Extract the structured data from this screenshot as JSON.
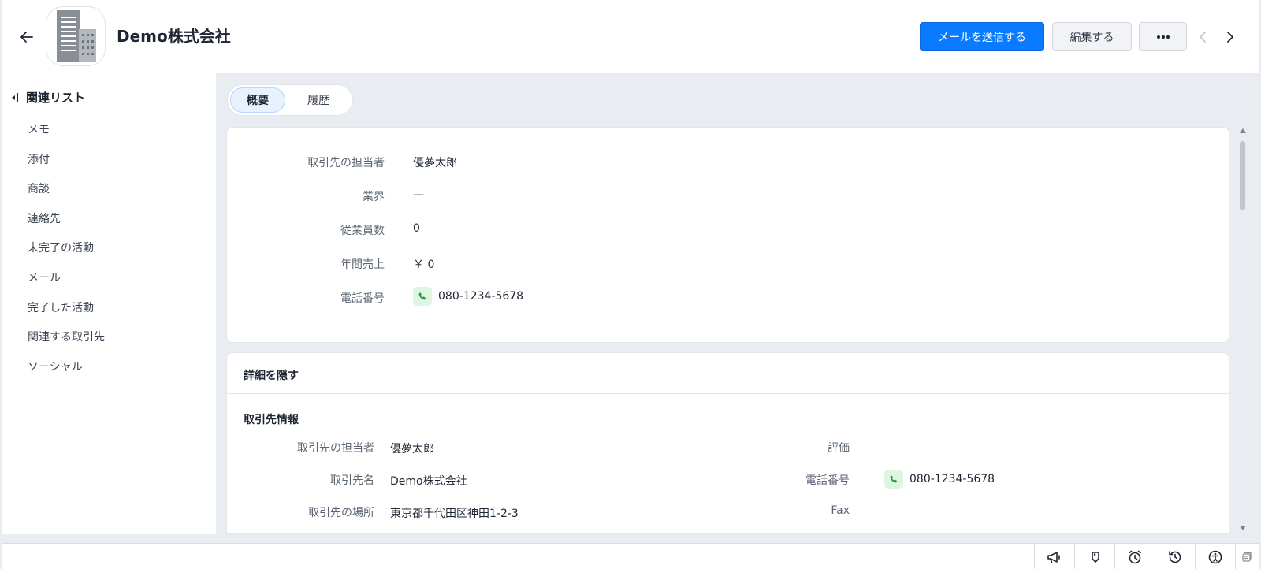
{
  "header": {
    "title": "Demo株式会社",
    "send_mail_label": "メールを送信する",
    "edit_label": "編集する",
    "more_label": "•••"
  },
  "sidebar": {
    "heading": "関連リスト",
    "items": [
      {
        "label": "メモ"
      },
      {
        "label": "添付"
      },
      {
        "label": "商談"
      },
      {
        "label": "連絡先"
      },
      {
        "label": "未完了の活動"
      },
      {
        "label": "メール"
      },
      {
        "label": "完了した活動"
      },
      {
        "label": "関連する取引先"
      },
      {
        "label": "ソーシャル"
      }
    ]
  },
  "tabs": [
    {
      "label": "概要",
      "active": true
    },
    {
      "label": "履歴",
      "active": false
    }
  ],
  "summary": {
    "fields": [
      {
        "label": "取引先の担当者",
        "value": "優夢太郎"
      },
      {
        "label": "業界",
        "value": "—"
      },
      {
        "label": "従業員数",
        "value": "0"
      },
      {
        "label": "年間売上",
        "value": "￥ 0"
      },
      {
        "label": "電話番号",
        "value": "080-1234-5678"
      }
    ]
  },
  "details": {
    "toggle_label": "詳細を隠す",
    "section_title": "取引先情報",
    "left_fields": [
      {
        "label": "取引先の担当者",
        "value": "優夢太郎"
      },
      {
        "label": "取引先名",
        "value": "Demo株式会社"
      },
      {
        "label": "取引先の場所",
        "value": "東京都千代田区神田1-2-3"
      }
    ],
    "right_fields": [
      {
        "label": "評価",
        "value": ""
      },
      {
        "label": "電話番号",
        "value": "080-1234-5678"
      },
      {
        "label": "Fax",
        "value": ""
      }
    ]
  },
  "colors": {
    "primary": "#0a7aff",
    "phone_chip_bg": "#ddf5e1",
    "phone_icon": "#1e9e3a",
    "page_bg": "#e9edf2"
  },
  "icons": {
    "bottom_bar": [
      "megaphone-icon",
      "tag-icon",
      "alarm-clock-icon",
      "history-icon",
      "accessibility-icon",
      "notes-icon"
    ]
  }
}
